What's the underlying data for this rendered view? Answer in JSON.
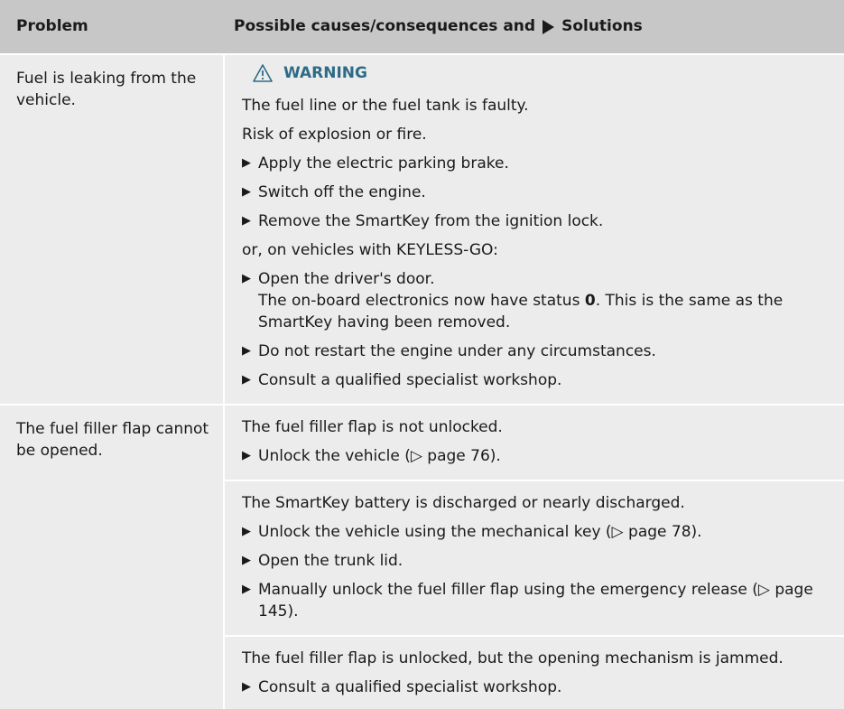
{
  "header": {
    "problem": "Problem",
    "solutions_prefix": "Possible causes/consequences and",
    "solutions_suffix": "Solutions"
  },
  "row1": {
    "problem": "Fuel is leaking from the vehicle.",
    "warning_label": "WARNING",
    "lines": [
      "The fuel line or the fuel tank is faulty.",
      "Risk of explosion or fire."
    ],
    "steps_a": [
      "Apply the electric parking brake.",
      "Switch off the engine.",
      "Remove the SmartKey from the ignition lock."
    ],
    "or_text": "or, on vehicles with KEYLESS-GO:",
    "step_door": "Open the driver's door.",
    "status_text_before": "The on-board electronics now have status",
    "status_value": "0",
    "status_text_after": ". This is the same as the SmartKey having been removed.",
    "steps_b": [
      "Do not restart the engine under any circumstances.",
      "Consult a qualified specialist workshop."
    ]
  },
  "row2": {
    "problem": "The fuel filler flap cannot be opened.",
    "block1": {
      "cause": "The fuel filler flap is not unlocked.",
      "step": "Unlock the vehicle (▷ page 76)."
    },
    "block2": {
      "cause": "The SmartKey battery is discharged or nearly discharged.",
      "steps": [
        "Unlock the vehicle using the mechanical key (▷ page 78).",
        "Open the trunk lid.",
        "Manually unlock the fuel filler flap using the emergency release (▷ page 145)."
      ]
    },
    "block3": {
      "cause": "The fuel filler flap is unlocked, but the opening mechanism is jammed.",
      "step": "Consult a qualified specialist workshop."
    }
  },
  "colors": {
    "header_bg": "#c7c7c7",
    "row_bg": "#ececec",
    "warning": "#2e6b88"
  }
}
